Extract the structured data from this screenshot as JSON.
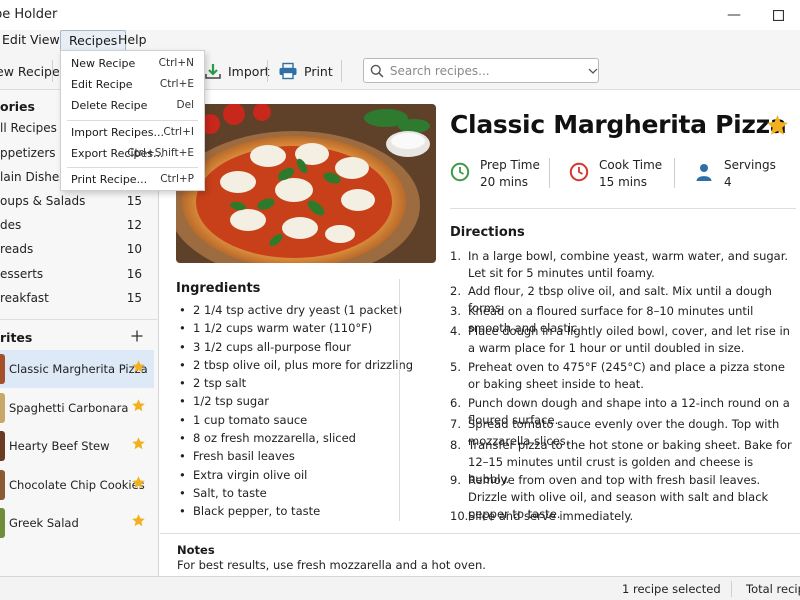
{
  "window": {
    "title": "Recipe Holder",
    "title_visible": "pe Holder"
  },
  "menubar": [
    {
      "label": "Edit",
      "visible": "Edit"
    },
    {
      "label": "View"
    },
    {
      "label": "Recipes"
    },
    {
      "label": "Help"
    }
  ],
  "toolbar": {
    "new_recipe": "New Recipe",
    "new_recipe_visible": "ew Recipe",
    "import": "Import",
    "print": "Print",
    "search_placeholder": "Search recipes..."
  },
  "dropdown": {
    "items": [
      {
        "label": "New Recipe",
        "shortcut": "Ctrl+N"
      },
      {
        "label": "Edit Recipe",
        "shortcut": "Ctrl+E"
      },
      {
        "label": "Delete Recipe",
        "shortcut": "Del"
      },
      {
        "label": "Import Recipes...",
        "shortcut": "Ctrl+I"
      },
      {
        "label": "Export Recipes...",
        "shortcut": "Ctrl+Shift+E"
      },
      {
        "label": "Print Recipe...",
        "shortcut": "Ctrl+P"
      }
    ]
  },
  "sidebar": {
    "categories_heading": "ories",
    "categories": [
      {
        "label": "ll Recipes",
        "count": ""
      },
      {
        "label": "ppetizers",
        "count": ""
      },
      {
        "label": "lain Dishes",
        "count": ""
      },
      {
        "label": "oups & Salads",
        "count": "15"
      },
      {
        "label": "des",
        "count": "12"
      },
      {
        "label": "reads",
        "count": "10"
      },
      {
        "label": "esserts",
        "count": "16"
      },
      {
        "label": "reakfast",
        "count": "15"
      }
    ],
    "favorites_heading": "rites",
    "favorites": [
      {
        "label": "Classic Margherita Pizza",
        "selected": true
      },
      {
        "label": "Spaghetti Carbonara"
      },
      {
        "label": "Hearty Beef Stew"
      },
      {
        "label": "Chocolate Chip Cookies"
      },
      {
        "label": "Greek Salad"
      }
    ]
  },
  "recipe": {
    "title": "Classic Margherita Pizza",
    "favorite": true,
    "prep_label": "Prep Time",
    "prep_value": "20 mins",
    "cook_label": "Cook Time",
    "cook_value": "15 mins",
    "servings_label": "Servings",
    "servings_value": "4",
    "ingredients_heading": "Ingredients",
    "ingredients": [
      "2 1/4 tsp active dry yeast (1 packet)",
      "1 1/2 cups warm water (110°F)",
      "3 1/2 cups all-purpose flour",
      "2 tbsp olive oil, plus more for drizzling",
      "2 tsp salt",
      "1/2 tsp sugar",
      "1 cup tomato sauce",
      "8 oz fresh mozzarella, sliced",
      "Fresh basil leaves",
      "Extra virgin olive oil",
      "Salt, to taste",
      "Black pepper, to taste"
    ],
    "directions_heading": "Directions",
    "directions": [
      {
        "n": "1.",
        "text": "In a large bowl, combine yeast, warm water, and sugar. Let sit for 5 minutes until foamy."
      },
      {
        "n": "2.",
        "text": "Add flour, 2 tbsp olive oil, and salt. Mix until a dough forms."
      },
      {
        "n": "3.",
        "text": "Knead on a floured surface for 8–10 minutes until smooth and elastic."
      },
      {
        "n": "4.",
        "text": "Place dough in a lightly oiled bowl, cover, and let rise in a warm place for 1 hour or until doubled in size."
      },
      {
        "n": "5.",
        "text": "Preheat oven to 475°F (245°C) and place a pizza stone or baking sheet inside to heat."
      },
      {
        "n": "6.",
        "text": "Punch down dough and shape into a 12-inch round on a floured surface."
      },
      {
        "n": "7.",
        "text": "Spread tomato sauce evenly over the dough. Top with mozzarella slices."
      },
      {
        "n": "8.",
        "text": "Transfer pizza to the hot stone or baking sheet. Bake for 12–15 minutes until crust is golden and cheese is bubbly."
      },
      {
        "n": "9.",
        "text": "Remove from oven and top with fresh basil leaves. Drizzle with olive oil, and season with salt and black pepper to taste."
      },
      {
        "n": "10.",
        "text": "Slice and serve immediately."
      }
    ],
    "notes_heading": "Notes",
    "notes_text": "For best results, use fresh mozzarella and a hot oven."
  },
  "status": {
    "selected": "1 recipe selected",
    "total": "Total recipes"
  },
  "colors": {
    "accent": "#3a7bd5",
    "star": "#f2b01e",
    "prep_icon": "#3f9b4a",
    "cook_icon": "#d9342b",
    "servings_icon": "#2f6fa8"
  }
}
